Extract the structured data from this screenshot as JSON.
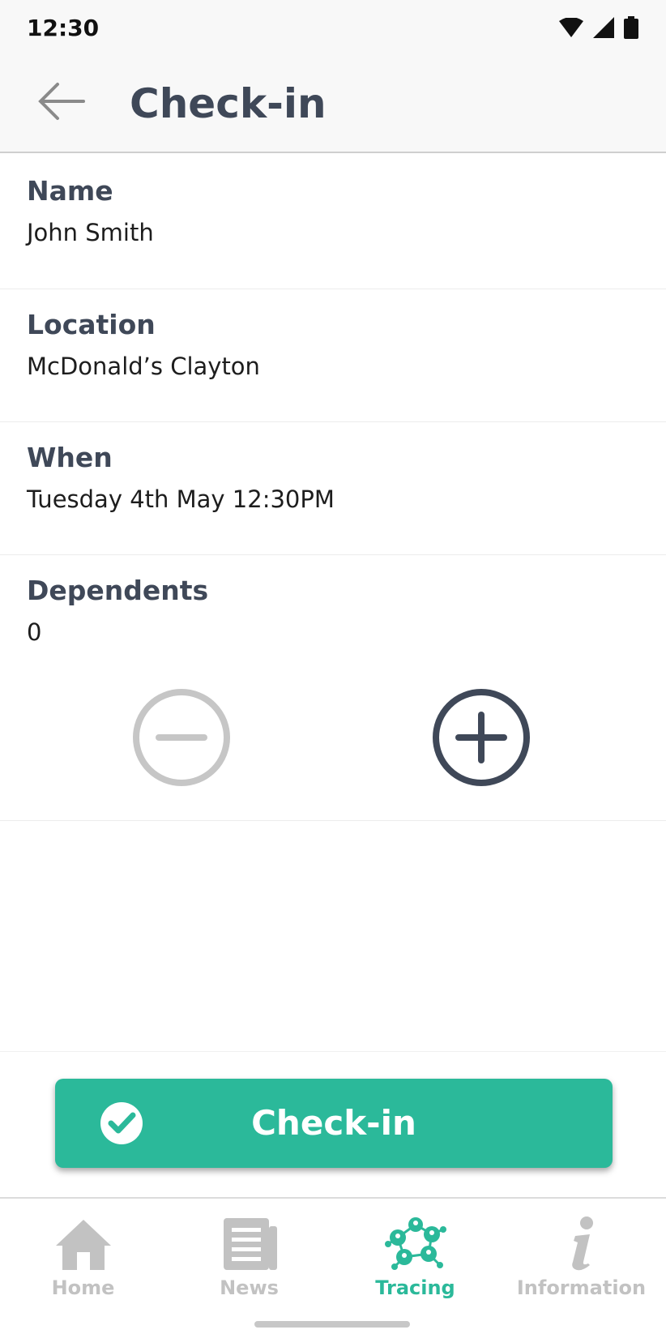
{
  "status_bar": {
    "time": "12:30"
  },
  "app_bar": {
    "title": "Check-in"
  },
  "fields": {
    "name": {
      "label": "Name",
      "value": "John Smith"
    },
    "location": {
      "label": "Location",
      "value": "McDonald’s Clayton"
    },
    "when": {
      "label": "When",
      "value": "Tuesday 4th May 12:30PM"
    },
    "dependents": {
      "label": "Dependents",
      "value": "0"
    }
  },
  "actions": {
    "checkin_label": "Check-in"
  },
  "bottom_nav": {
    "items": [
      {
        "label": "Home",
        "icon": "home-icon",
        "active": false
      },
      {
        "label": "News",
        "icon": "news-icon",
        "active": false
      },
      {
        "label": "Tracing",
        "icon": "tracing-icon",
        "active": true
      },
      {
        "label": "Information",
        "icon": "info-icon",
        "active": false
      }
    ]
  },
  "colors": {
    "accent": "#2bb99a",
    "heading": "#3f4858",
    "disabled": "#c2c2c2"
  }
}
